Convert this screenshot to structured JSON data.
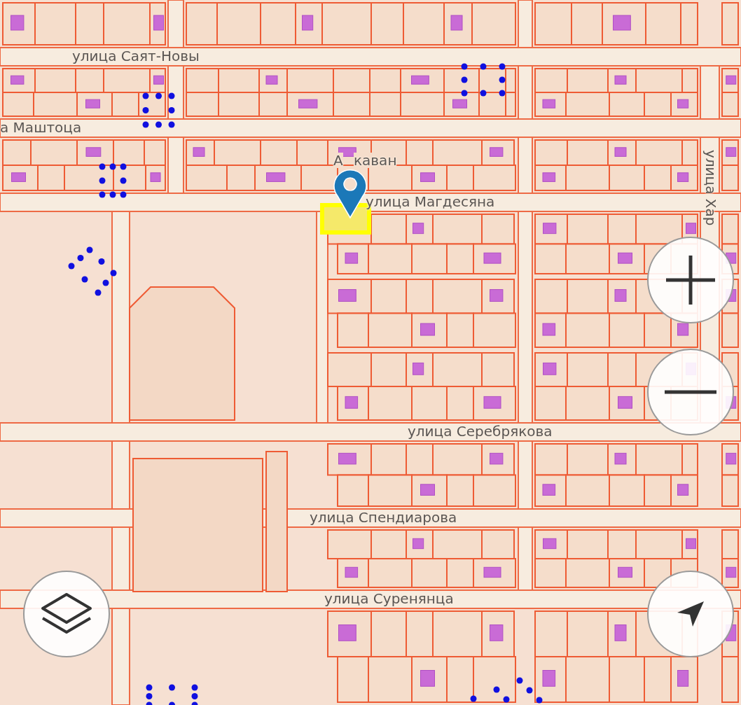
{
  "map": {
    "street_labels": [
      {
        "text": "улица Саят-Новы",
        "kind": "horizontal"
      },
      {
        "text": "а Маштоца",
        "kind": "horizontal"
      },
      {
        "text": "А",
        "kind": "horizontal"
      },
      {
        "text": "каван",
        "kind": "horizontal"
      },
      {
        "text": "улица Магдесяна",
        "kind": "horizontal"
      },
      {
        "text": "улица Хар",
        "kind": "vertical"
      },
      {
        "text": "улица Серебрякова",
        "kind": "horizontal"
      },
      {
        "text": "улица Спендиарова",
        "kind": "horizontal"
      },
      {
        "text": "улица Суренянца",
        "kind": "horizontal"
      }
    ]
  },
  "controls": [
    {
      "kind": "zoom_in"
    },
    {
      "kind": "zoom_out"
    },
    {
      "kind": "layers"
    },
    {
      "kind": "locate"
    }
  ]
}
